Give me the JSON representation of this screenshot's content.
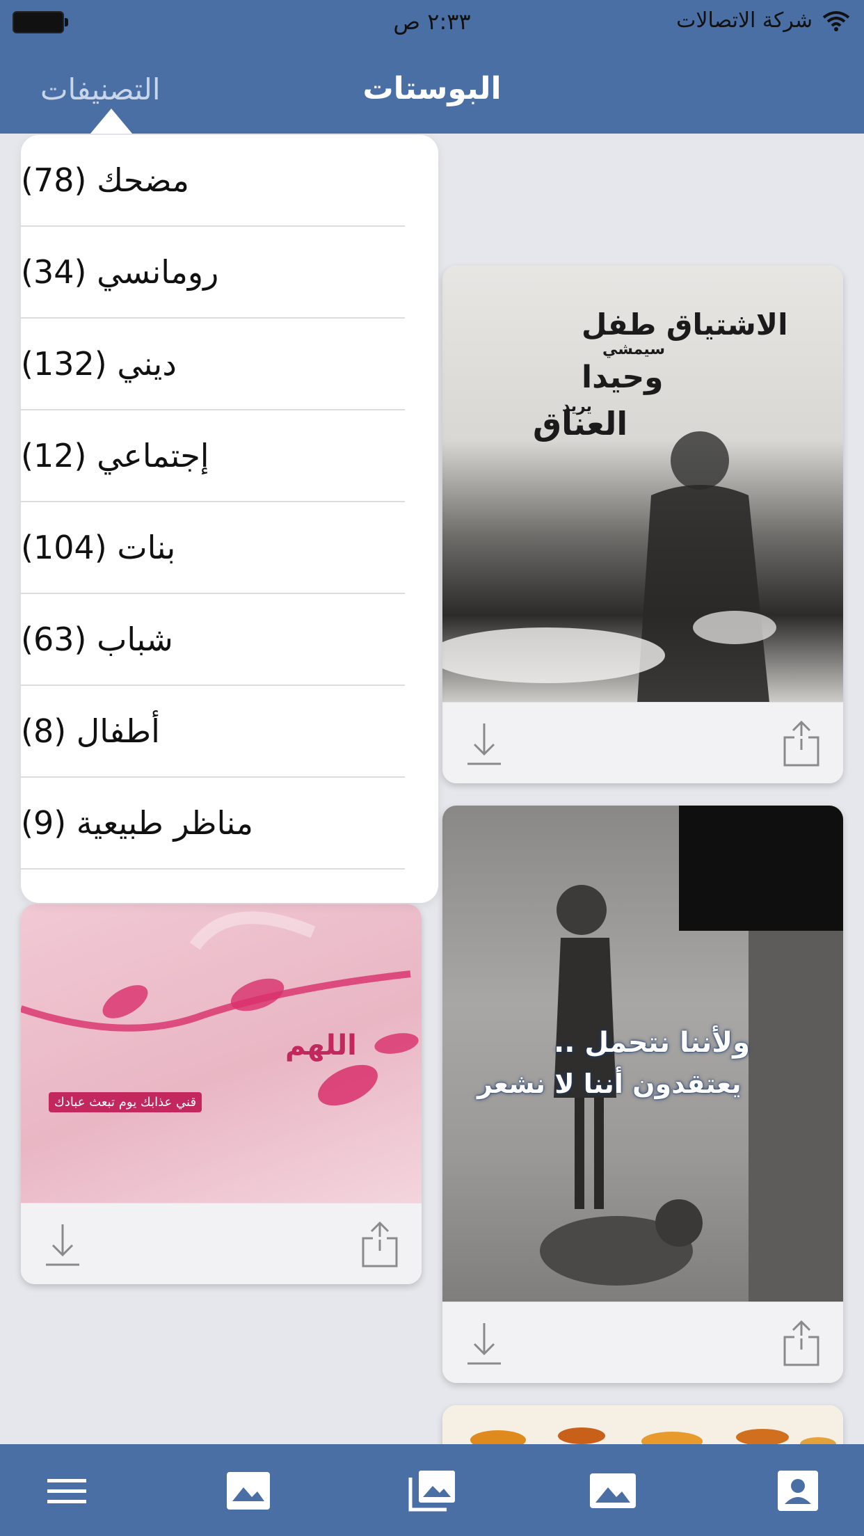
{
  "status_bar": {
    "time": "٢:٣٣ ص",
    "carrier": "شركة الاتصالات"
  },
  "nav": {
    "title": "البوستات",
    "categories_button": "التصنيفات"
  },
  "categories_menu": [
    {
      "label": "مضحك (78)"
    },
    {
      "label": "رومانسي (34)"
    },
    {
      "label": "ديني (132)"
    },
    {
      "label": "إجتماعي (12)"
    },
    {
      "label": "بنات (104)"
    },
    {
      "label": "شباب (63)"
    },
    {
      "label": "أطفال (8)"
    },
    {
      "label": "مناظر طبيعية (9)"
    }
  ],
  "posts": [
    {
      "text_lines": [
        "الاشتياق طفل",
        "سيمشي",
        "وحيدا",
        "يريد",
        "العناق"
      ]
    },
    {
      "text_lines": [
        "اللهم",
        "قني عذابك يوم تبعث عبادك"
      ]
    },
    {
      "text_lines": [
        "ولأننا نتحمل ..",
        "يعتقدون أننا لا نشعر"
      ]
    }
  ],
  "colors": {
    "bar": "#4a6fa5",
    "background": "#e6e7ec",
    "card_footer": "#f2f2f4"
  },
  "icons": {
    "card_actions": [
      "download-icon",
      "share-icon"
    ],
    "tabs": [
      "menu-icon",
      "image-icon",
      "gallery-icon",
      "photo-icon",
      "profile-icon"
    ]
  }
}
